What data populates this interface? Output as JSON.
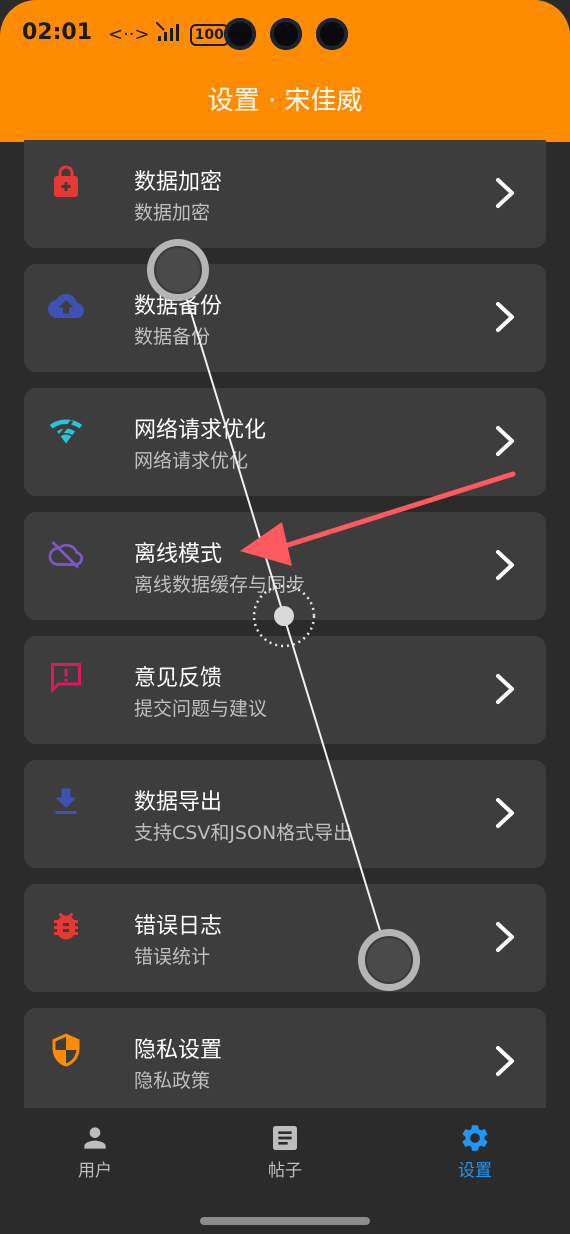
{
  "status_bar": {
    "time": "02:01",
    "network_glyph": "<··>",
    "battery": "100"
  },
  "header": {
    "title": "设置 · 宋佳威"
  },
  "settings": [
    {
      "title": "数据加密",
      "subtitle": "数据加密",
      "icon": "lock-icon",
      "color": "#e53935"
    },
    {
      "title": "数据备份",
      "subtitle": "数据备份",
      "icon": "cloud-upload-icon",
      "color": "#3f51b5"
    },
    {
      "title": "网络请求优化",
      "subtitle": "网络请求优化",
      "icon": "wifi-icon",
      "color": "#26c6da"
    },
    {
      "title": "离线模式",
      "subtitle": "离线数据缓存与同步",
      "icon": "cloud-off-icon",
      "color": "#7e57c2"
    },
    {
      "title": "意见反馈",
      "subtitle": "提交问题与建议",
      "icon": "feedback-icon",
      "color": "#d81b60"
    },
    {
      "title": "数据导出",
      "subtitle": "支持CSV和JSON格式导出",
      "icon": "download-icon",
      "color": "#3f51b5"
    },
    {
      "title": "错误日志",
      "subtitle": "错误统计",
      "icon": "bug-icon",
      "color": "#e53935"
    },
    {
      "title": "隐私设置",
      "subtitle": "隐私政策",
      "icon": "shield-icon",
      "color": "#fb8c00"
    }
  ],
  "bottom_nav": {
    "items": [
      {
        "label": "用户",
        "icon": "person-icon",
        "active": false
      },
      {
        "label": "帖子",
        "icon": "article-icon",
        "active": false
      },
      {
        "label": "设置",
        "icon": "gear-icon",
        "active": true
      }
    ],
    "active_color": "#2196f3",
    "inactive_color": "#bdbdbd"
  },
  "colors": {
    "header_bg": "#ff8c00",
    "card_bg": "#3d3d3d",
    "page_bg": "#2b2b2b",
    "annotation_arrow": "#ff5a5f"
  }
}
